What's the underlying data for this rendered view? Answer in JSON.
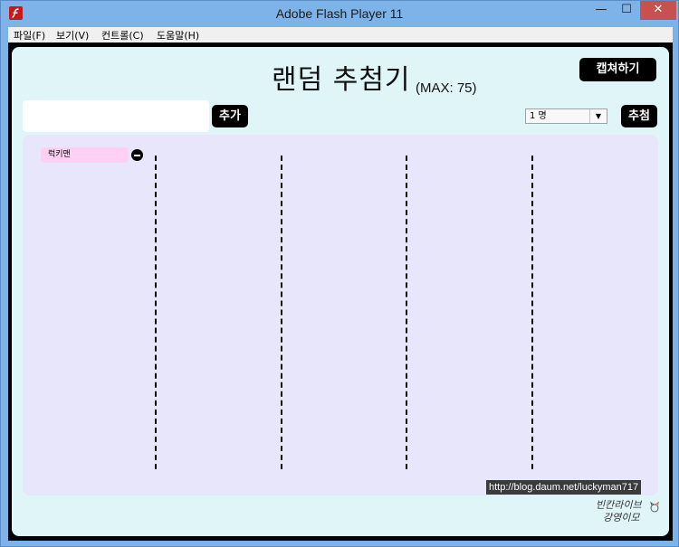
{
  "window": {
    "title": "Adobe Flash Player 11",
    "controls": {
      "minimize": "—",
      "maximize": "☐",
      "close": "✕"
    },
    "close_color": "#c75050",
    "frame_color": "#7eb3ea"
  },
  "menu": {
    "items": [
      {
        "label": "파일(F)"
      },
      {
        "label": "보기(V)"
      },
      {
        "label": "컨트롤(C)"
      },
      {
        "label": "도움말(H)"
      }
    ]
  },
  "app": {
    "title": "랜덤 추첨기",
    "max_label": "(MAX: 75)",
    "capture_button": "캡쳐하기",
    "name_input": {
      "value": "",
      "placeholder": ""
    },
    "add_button": "추가",
    "count_select": {
      "selected": "1 명"
    },
    "draw_button": "추첨",
    "entries": [
      {
        "name": "럭키맨"
      }
    ],
    "stage_color": "#dff5f8",
    "panel_color": "#e7e6fa",
    "chip_color": "#ffd0f3"
  },
  "watermark": "http://blog.daum.net/luckyman717",
  "logo_text": [
    "빈칸라이브",
    "강영이모"
  ]
}
